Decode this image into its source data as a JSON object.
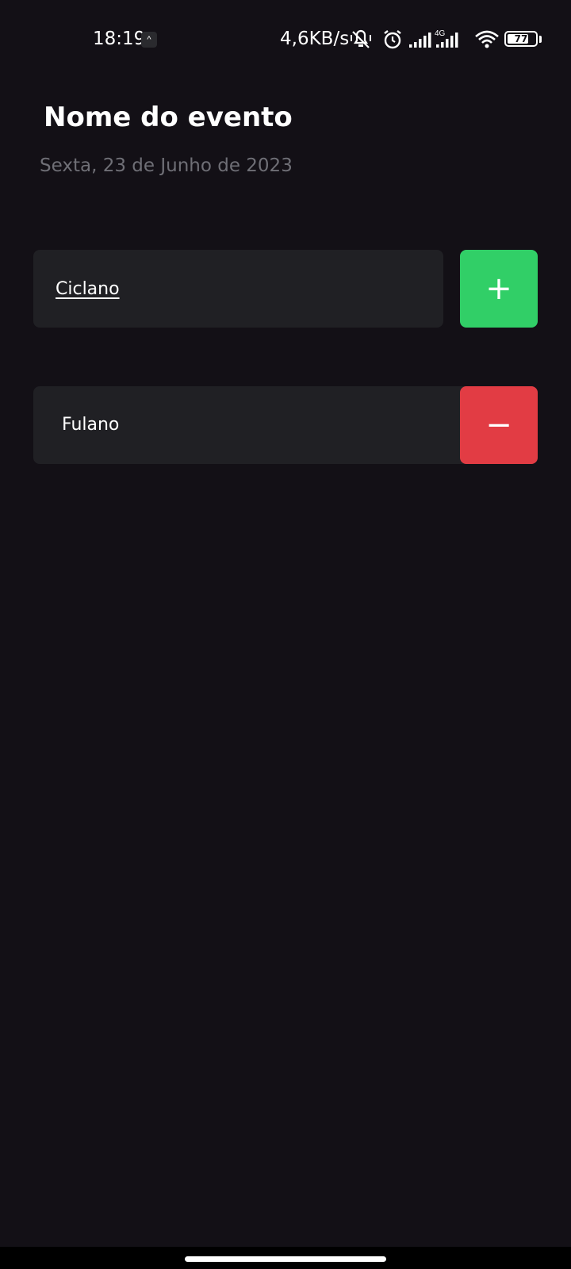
{
  "status_bar": {
    "time": "18:19",
    "app_notification_icon": "activity-icon",
    "network_speed": "4,6KB/s",
    "icons": [
      "vibrate-mute-icon",
      "alarm-icon",
      "signal-icon",
      "signal-4g-icon",
      "wifi-icon"
    ],
    "network_type": "4G",
    "battery_level": "77",
    "battery_fraction": 0.77
  },
  "header": {
    "title": "Nome do evento",
    "date": "Sexta, 23 de Junho de 2023"
  },
  "add_form": {
    "input_value": "Ciclano",
    "add_button_label": "+",
    "add_button_color": "#31cf67"
  },
  "participants": [
    {
      "name": "Fulano",
      "remove_button_label": "−",
      "remove_button_color": "#e23c44"
    }
  ],
  "colors": {
    "background": "#131016",
    "card": "#202024",
    "muted_text": "#6f6f76"
  }
}
